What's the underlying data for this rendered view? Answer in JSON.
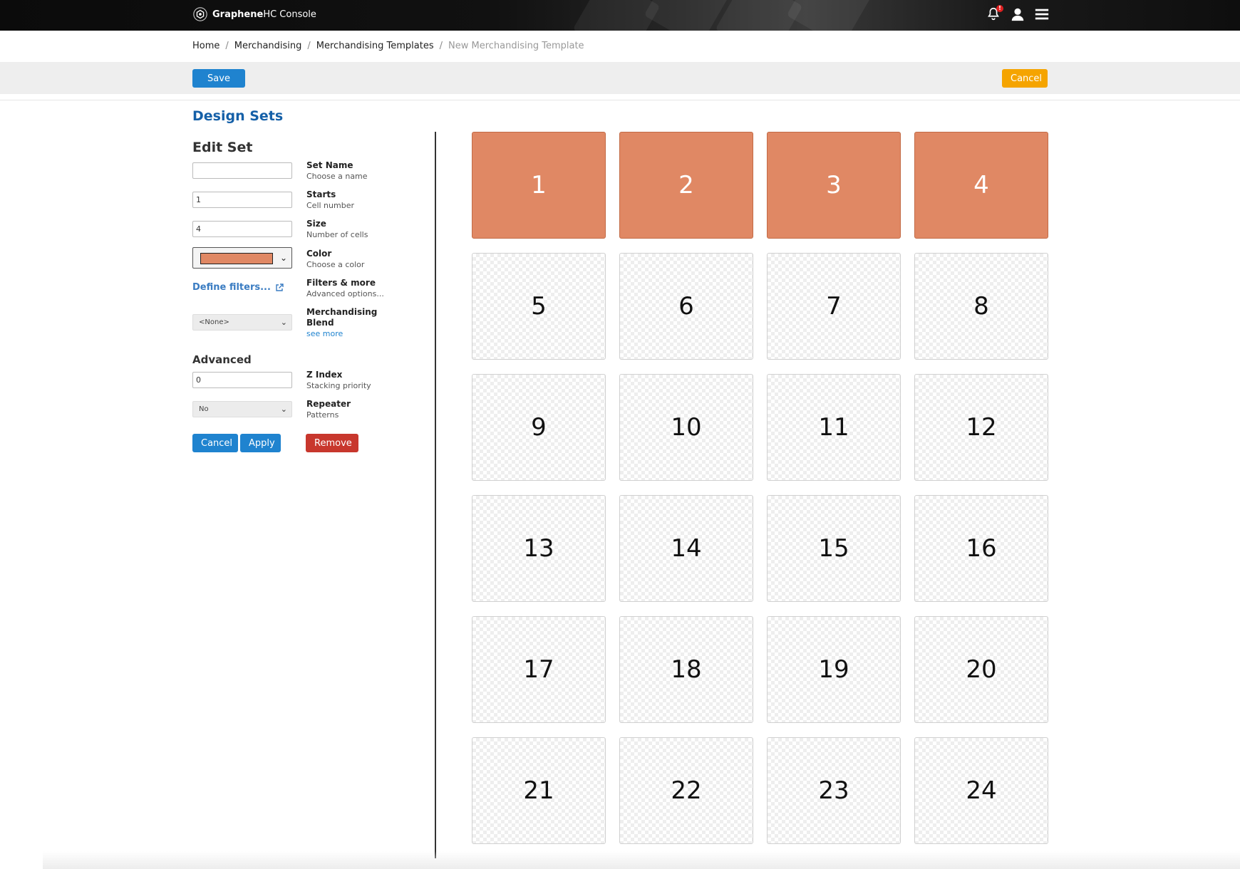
{
  "app": {
    "brand_bold": "Graphene",
    "brand_rest": "HC Console",
    "notification_badge": "!"
  },
  "breadcrumb": [
    {
      "label": "Home"
    },
    {
      "label": "Merchandising"
    },
    {
      "label": "Merchandising Templates"
    },
    {
      "label": "New Merchandising Template"
    }
  ],
  "breadcrumb_sep": "/",
  "actions": {
    "save_label": "Save",
    "cancel_label": "Cancel"
  },
  "panel": {
    "title": "Design Sets",
    "edit_title": "Edit Set",
    "fields": {
      "set_name": {
        "value": "",
        "label": "Set Name",
        "sub": "Choose a name"
      },
      "starts": {
        "value": "1",
        "label": "Starts",
        "sub": "Cell number"
      },
      "size": {
        "value": "4",
        "label": "Size",
        "sub": "Number of cells"
      },
      "color": {
        "value": "#e08864",
        "label": "Color",
        "sub": "Choose a color"
      },
      "filters": {
        "link": "Define filters...",
        "label": "Filters & more",
        "sub": "Advanced options..."
      },
      "blend": {
        "value": "<None>",
        "label": "Merchandising Blend",
        "link": "see more"
      }
    },
    "advanced_title": "Advanced",
    "advanced": {
      "zindex": {
        "value": "0",
        "label": "Z Index",
        "sub": "Stacking priority"
      },
      "repeater": {
        "value": "No",
        "label": "Repeater",
        "sub": "Patterns"
      }
    },
    "buttons": {
      "cancel": "Cancel",
      "apply": "Apply",
      "remove": "Remove"
    }
  },
  "grid": {
    "highlight_color": "#e08864",
    "cells": [
      {
        "n": "1",
        "active": true
      },
      {
        "n": "2",
        "active": true
      },
      {
        "n": "3",
        "active": true
      },
      {
        "n": "4",
        "active": true
      },
      {
        "n": "5",
        "active": false
      },
      {
        "n": "6",
        "active": false
      },
      {
        "n": "7",
        "active": false
      },
      {
        "n": "8",
        "active": false
      },
      {
        "n": "9",
        "active": false
      },
      {
        "n": "10",
        "active": false
      },
      {
        "n": "11",
        "active": false
      },
      {
        "n": "12",
        "active": false
      },
      {
        "n": "13",
        "active": false
      },
      {
        "n": "14",
        "active": false
      },
      {
        "n": "15",
        "active": false
      },
      {
        "n": "16",
        "active": false
      },
      {
        "n": "17",
        "active": false
      },
      {
        "n": "18",
        "active": false
      },
      {
        "n": "19",
        "active": false
      },
      {
        "n": "20",
        "active": false
      },
      {
        "n": "21",
        "active": false
      },
      {
        "n": "22",
        "active": false
      },
      {
        "n": "23",
        "active": false
      },
      {
        "n": "24",
        "active": false
      }
    ]
  }
}
